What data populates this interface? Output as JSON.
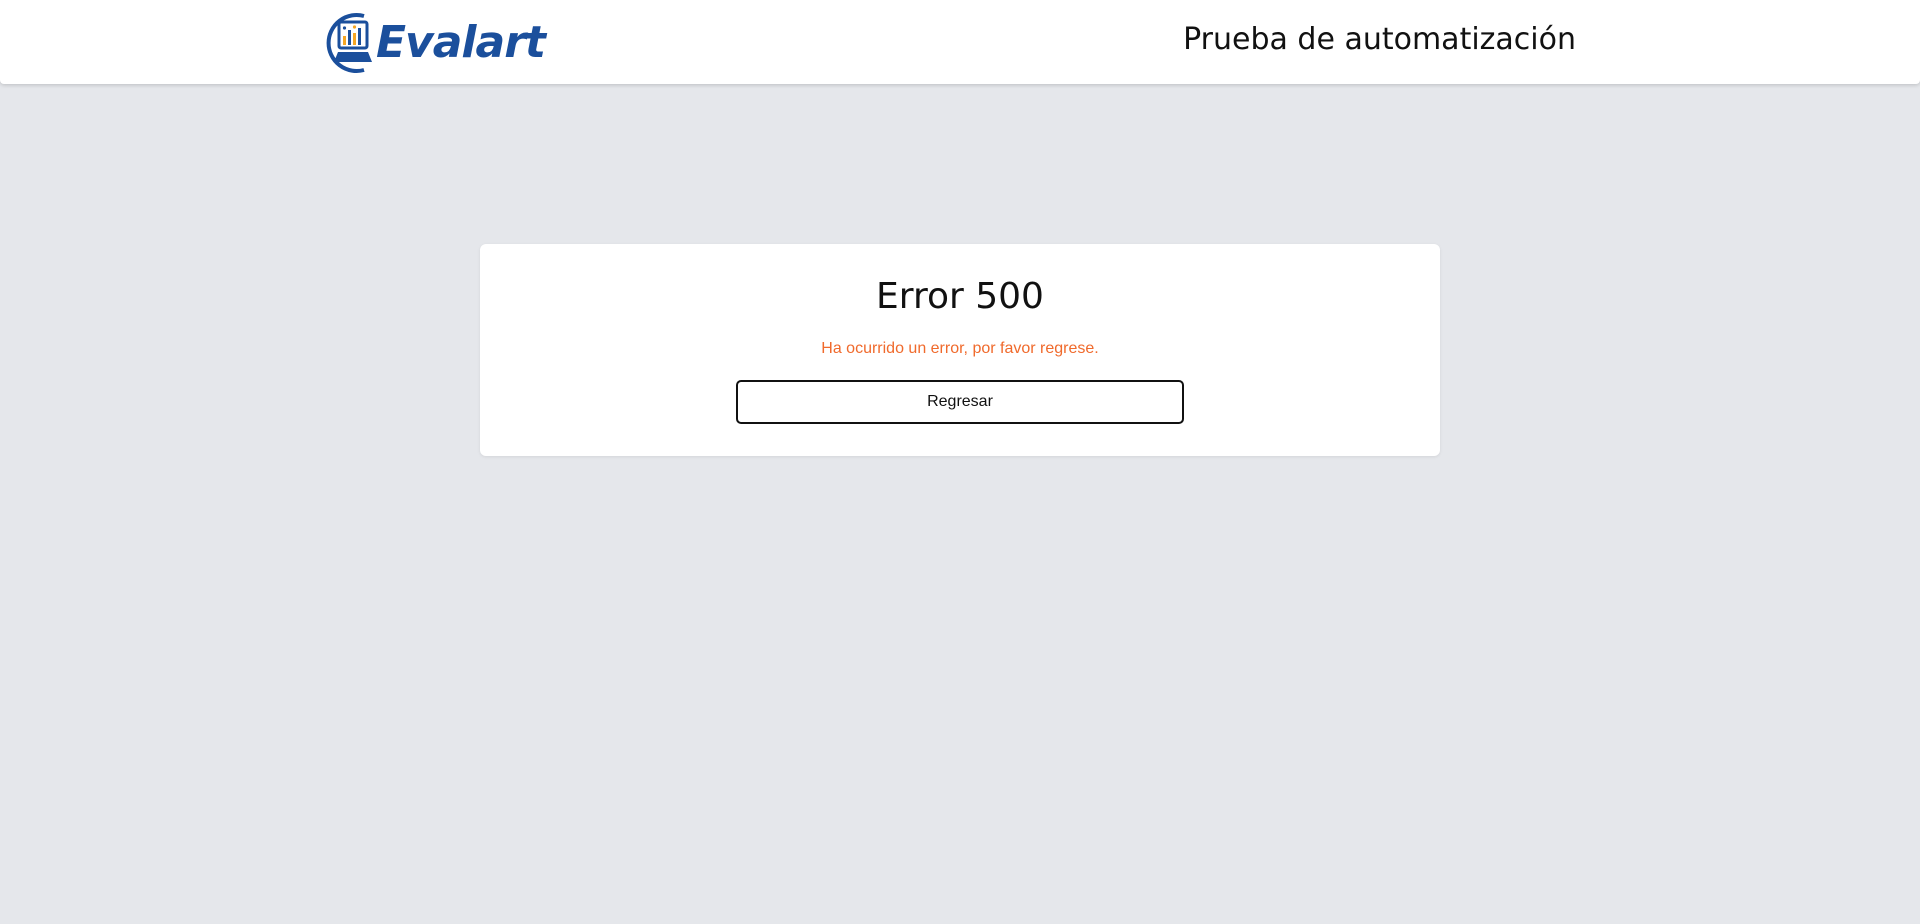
{
  "header": {
    "logo_text": "Evalart",
    "title": "Prueba de automatización"
  },
  "error": {
    "title": "Error 500",
    "message": "Ha ocurrido un error, por favor regrese.",
    "button_label": "Regresar"
  },
  "colors": {
    "background": "#e5e7eb",
    "brand_blue": "#1b4f9c",
    "message_orange": "#f06a2c",
    "text_dark": "#111111"
  }
}
